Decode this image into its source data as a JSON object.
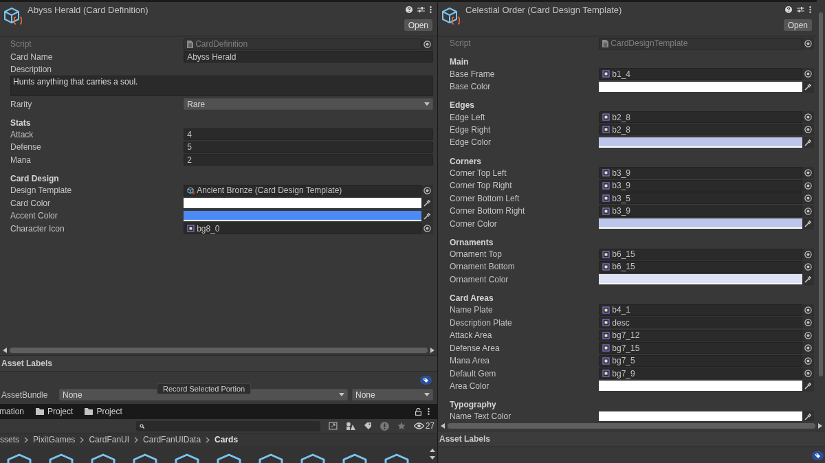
{
  "inspectors": [
    {
      "title": "Abyss Herald (Card Definition)",
      "open_button": "Open",
      "asset_labels": "Asset Labels",
      "rows": [
        {
          "kind": "script",
          "label": "Script",
          "value": "CardDefinition"
        },
        {
          "kind": "text",
          "label": "Card Name",
          "value": "Abyss Herald"
        },
        {
          "kind": "textarea",
          "label": "Description",
          "value": "Hunts anything that carries a soul."
        },
        {
          "kind": "dropdown",
          "label": "Rarity",
          "value": "Rare"
        },
        {
          "kind": "header",
          "label": "Stats"
        },
        {
          "kind": "text",
          "label": "Attack",
          "value": "4"
        },
        {
          "kind": "text",
          "label": "Defense",
          "value": "5"
        },
        {
          "kind": "text",
          "label": "Mana",
          "value": "2"
        },
        {
          "kind": "header",
          "label": "Card Design"
        },
        {
          "kind": "object",
          "label": "Design Template",
          "value": "Ancient Bronze (Card Design Template)"
        },
        {
          "kind": "color",
          "label": "Card Color",
          "color": "#ffffff"
        },
        {
          "kind": "color",
          "label": "Accent Color",
          "color": "#4c8af5"
        },
        {
          "kind": "sprite",
          "label": "Character Icon",
          "value": "bg8_0"
        }
      ]
    },
    {
      "title": "Celestial Order (Card Design Template)",
      "open_button": "Open",
      "asset_labels": "Asset Labels",
      "rows": [
        {
          "kind": "script",
          "label": "Script",
          "value": "CardDesignTemplate"
        },
        {
          "kind": "header",
          "label": "Main"
        },
        {
          "kind": "sprite",
          "label": "Base Frame",
          "value": "b1_4"
        },
        {
          "kind": "color",
          "label": "Base Color",
          "color": "#ffffff"
        },
        {
          "kind": "header",
          "label": "Edges"
        },
        {
          "kind": "sprite",
          "label": "Edge Left",
          "value": "b2_8"
        },
        {
          "kind": "sprite",
          "label": "Edge Right",
          "value": "b2_8"
        },
        {
          "kind": "color",
          "label": "Edge Color",
          "color": "#bcc6ea"
        },
        {
          "kind": "header",
          "label": "Corners"
        },
        {
          "kind": "sprite",
          "label": "Corner Top Left",
          "value": "b3_9"
        },
        {
          "kind": "sprite",
          "label": "Corner Top Right",
          "value": "b3_9"
        },
        {
          "kind": "sprite",
          "label": "Corner Bottom Left",
          "value": "b3_5"
        },
        {
          "kind": "sprite",
          "label": "Corner Bottom Right",
          "value": "b3_9"
        },
        {
          "kind": "color",
          "label": "Corner Color",
          "color": "#bcc6ea"
        },
        {
          "kind": "header",
          "label": "Ornaments"
        },
        {
          "kind": "sprite",
          "label": "Ornament Top",
          "value": "b6_15"
        },
        {
          "kind": "sprite",
          "label": "Ornament Bottom",
          "value": "b6_15"
        },
        {
          "kind": "color",
          "label": "Ornament Color",
          "color": "#dde2f5"
        },
        {
          "kind": "header",
          "label": "Card Areas"
        },
        {
          "kind": "sprite",
          "label": "Name Plate",
          "value": "b4_1"
        },
        {
          "kind": "sprite",
          "label": "Description Plate",
          "value": "desc"
        },
        {
          "kind": "sprite",
          "label": "Attack Area",
          "value": "bg7_12"
        },
        {
          "kind": "sprite",
          "label": "Defense Area",
          "value": "bg7_15"
        },
        {
          "kind": "sprite",
          "label": "Mana Area",
          "value": "bg7_5"
        },
        {
          "kind": "sprite",
          "label": "Default Gem",
          "value": "bg7_9"
        },
        {
          "kind": "color",
          "label": "Area Color",
          "color": "#ffffff"
        },
        {
          "kind": "header",
          "label": "Typography"
        },
        {
          "kind": "color",
          "label": "Name Text Color",
          "color": "#ffffff"
        }
      ]
    }
  ],
  "asset_bundle": {
    "label": "AssetBundle",
    "bundle": "None",
    "variant": "None"
  },
  "tooltip": "Record Selected Portion",
  "project": {
    "tabs": [
      {
        "label": "mation",
        "folder": false
      },
      {
        "label": "Project",
        "folder": true
      },
      {
        "label": "Project",
        "folder": true
      }
    ],
    "hidden_count": "27",
    "breadcrumb": [
      "ssets",
      "PixitGames",
      "CardFanUI",
      "CardFanUIData",
      "Cards"
    ]
  }
}
